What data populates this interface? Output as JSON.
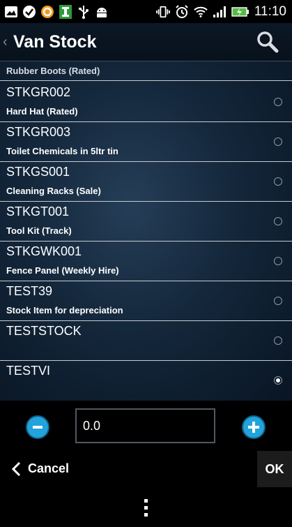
{
  "status_bar": {
    "time": "11:10",
    "left_icons": [
      "image-icon",
      "check-icon",
      "sync-icon",
      "app-icon",
      "usb-icon",
      "android-icon"
    ],
    "right_icons": [
      "vibrate-icon",
      "alarm-icon",
      "wifi-icon",
      "signal-icon",
      "battery-icon"
    ]
  },
  "action_bar": {
    "title": "Van Stock",
    "up_glyph": "‹"
  },
  "list": {
    "partial_top": {
      "description": "Rubber Boots (Rated)"
    },
    "items": [
      {
        "code": "STKGR002",
        "description": "Hard Hat (Rated)",
        "selected": false
      },
      {
        "code": "STKGR003",
        "description": "Toilet Chemicals in 5ltr tin",
        "selected": false
      },
      {
        "code": "STKGS001",
        "description": "Cleaning Racks (Sale)",
        "selected": false
      },
      {
        "code": "STKGT001",
        "description": "Tool Kit (Track)",
        "selected": false
      },
      {
        "code": "STKGWK001",
        "description": "Fence Panel (Weekly Hire)",
        "selected": false
      },
      {
        "code": "TEST39",
        "description": "Stock Item for depreciation",
        "selected": false
      },
      {
        "code": "TESTSTOCK",
        "description": "",
        "selected": false
      },
      {
        "code": "TESTVI",
        "description": "",
        "selected": true
      }
    ]
  },
  "quantity": {
    "value": "0.0"
  },
  "footer": {
    "cancel_label": "Cancel",
    "ok_label": "OK"
  },
  "colors": {
    "accent": "#22a3dc",
    "action_bar": "#0c1826",
    "list_center": "#253e57"
  }
}
